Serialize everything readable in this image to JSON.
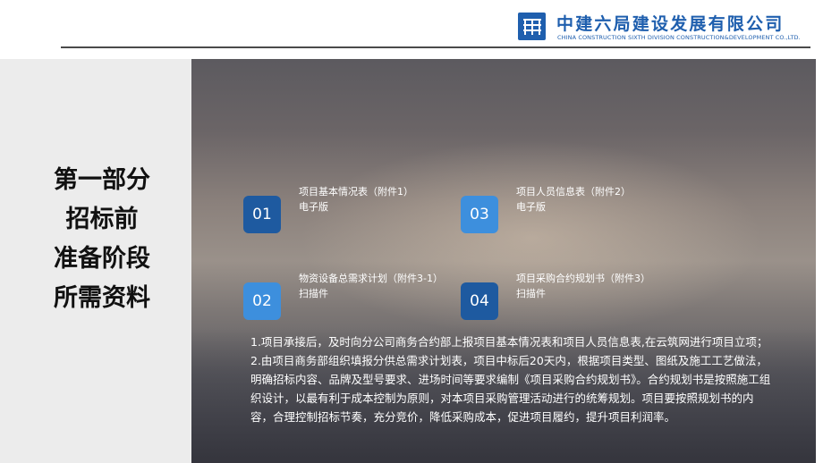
{
  "header": {
    "company_cn": "中建六局建设发展有限公司",
    "company_en": "CHINA CONSTRUCTION SIXTH DIVISION CONSTRUCTION&DEVELOPMENT CO.,LTD.",
    "logo_icon": "cscec-logo-icon",
    "brand_color": "#1f5fae"
  },
  "section": {
    "lines": [
      "第一部分",
      "招标前",
      "准备阶段",
      "所需资料"
    ]
  },
  "items": [
    {
      "number": "01",
      "title": "项目基本情况表（附件1）",
      "form": "电子版"
    },
    {
      "number": "03",
      "title": "项目人员信息表（附件2）",
      "form": "电子版"
    },
    {
      "number": "02",
      "title": "物资设备总需求计划（附件3-1）",
      "form": "扫描件"
    },
    {
      "number": "04",
      "title": "项目采购合约规划书（附件3）",
      "form": "扫描件"
    }
  ],
  "body": {
    "p1": "1.项目承接后，及时向分公司商务合约部上报项目基本情况表和项目人员信息表,在云筑网进行项目立项；",
    "p2": "2.由项目商务部组织填报分供总需求计划表，项目中标后20天内，根据项目类型、图纸及施工工艺做法，明确招标内容、品牌及型号要求、进场时间等要求编制《项目采购合约规划书》。合约规划书是按照施工组织设计，以最有利于成本控制为原则，对本项目采购管理活动进行的统筹规划。项目要按照规划书的内容，合理控制招标节奏，充分竞价，降低采购成本，促进项目履约，提升项目利润率。"
  }
}
